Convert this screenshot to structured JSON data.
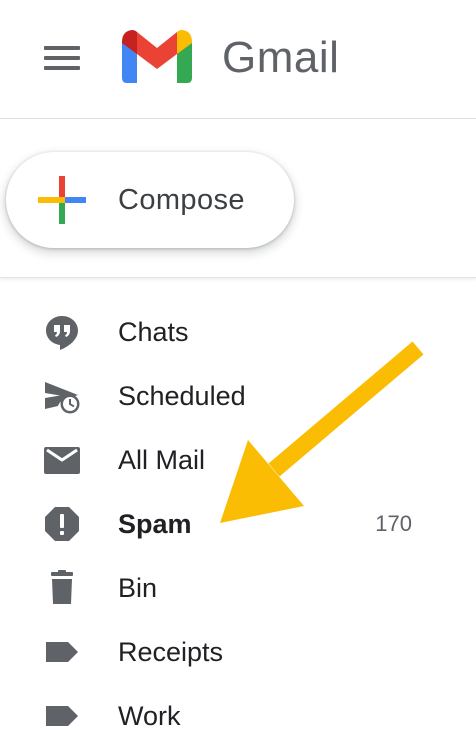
{
  "header": {
    "menu_icon": "hamburger-menu-icon",
    "logo_icon": "gmail-logo-icon",
    "title": "Gmail"
  },
  "compose": {
    "label": "Compose",
    "icon": "colorful-plus-icon"
  },
  "nav": {
    "items": [
      {
        "label": "Chats",
        "icon": "chat-bubble-icon",
        "count": "",
        "bold": false
      },
      {
        "label": "Scheduled",
        "icon": "scheduled-send-icon",
        "count": "",
        "bold": false
      },
      {
        "label": "All Mail",
        "icon": "envelope-icon",
        "count": "",
        "bold": false
      },
      {
        "label": "Spam",
        "icon": "spam-warning-icon",
        "count": "170",
        "bold": true
      },
      {
        "label": "Bin",
        "icon": "trash-can-icon",
        "count": "",
        "bold": false
      },
      {
        "label": "Receipts",
        "icon": "label-tag-icon",
        "count": "",
        "bold": false
      },
      {
        "label": "Work",
        "icon": "label-tag-icon",
        "count": "",
        "bold": false
      }
    ]
  },
  "annotation": {
    "icon": "yellow-arrow-icon",
    "color": "#FBBC04"
  },
  "colors": {
    "icon_grey": "#5f6368",
    "text": "#202124",
    "google_blue": "#4285F4",
    "google_red": "#EA4335",
    "google_yellow": "#FBBC04",
    "google_green": "#34A853"
  }
}
